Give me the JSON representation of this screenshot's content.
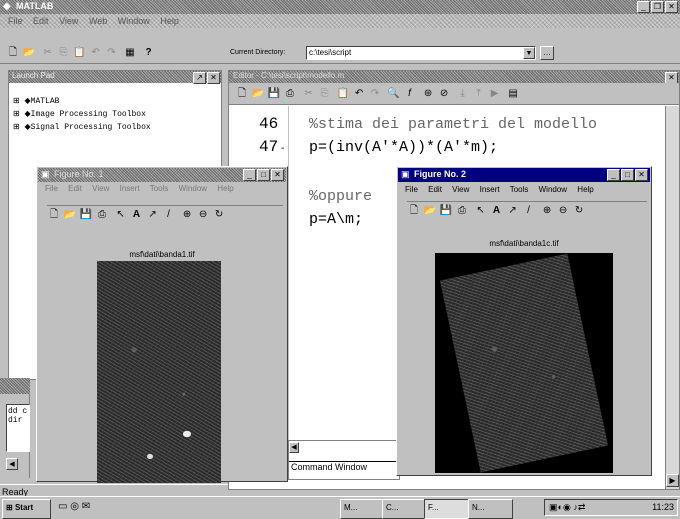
{
  "main_window": {
    "title": "MATLAB",
    "menu": [
      "File",
      "Edit",
      "View",
      "Web",
      "Window",
      "Help"
    ],
    "current_directory_label": "Current Directory:",
    "current_directory_value": "c:\\tesi\\script",
    "help_glyph": "?"
  },
  "launch_pad": {
    "title": "Launch Pad",
    "items": [
      "MATLAB",
      "Image Processing Toolbox",
      "Signal Processing Toolbox"
    ]
  },
  "editor": {
    "title": "Editor - C:\\tesi\\script\\modello.m",
    "lines": [
      {
        "num": "46",
        "code": "%stima dei parametri del modello"
      },
      {
        "num": "47",
        "code": "p=(inv(A'*A))*(A'*m);"
      },
      {
        "num": "",
        "code": "%oppure"
      },
      {
        "num": "",
        "code": "p=A\\m;"
      }
    ]
  },
  "figure1": {
    "title": "Figure No. 1",
    "menu": [
      "File",
      "Edit",
      "View",
      "Insert",
      "Tools",
      "Window",
      "Help"
    ],
    "image_title": "msf\\dati\\banda1.tif"
  },
  "figure2": {
    "title": "Figure No. 2",
    "menu": [
      "File",
      "Edit",
      "View",
      "Insert",
      "Tools",
      "Window",
      "Help"
    ],
    "image_title": "msf\\dati\\banda1c.tif"
  },
  "command_window": {
    "tab_label": "Command Window",
    "lines": [
      "dd c",
      "dir"
    ]
  },
  "status": {
    "ready": "Ready"
  },
  "taskbar": {
    "start": "Start",
    "buttons": [
      "M...",
      "C...",
      "F...",
      "N..."
    ],
    "clock": "11:23"
  },
  "colors": {
    "desktop_gray": "#c0c0c0",
    "white": "#ffffff",
    "black": "#000000"
  }
}
